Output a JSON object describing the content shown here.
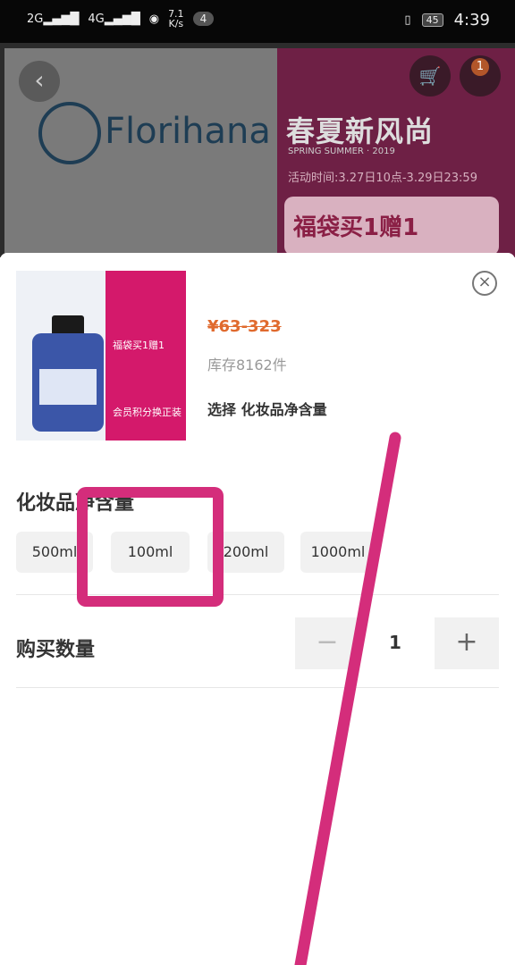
{
  "status_bar": {
    "net1": "2G",
    "net2": "4G",
    "speed_value": "7.1",
    "speed_unit": "K/s",
    "notif_count": "4",
    "battery": "45",
    "time": "4:39"
  },
  "background": {
    "brand": "Florihana",
    "promo_title": "春夏新风尚",
    "promo_subtitle": "SPRING SUMMER · 2019",
    "promo_time": "活动时间:3.27日10点-3.29日23:59",
    "promo_banner": "福袋买1赠1",
    "cart_badge": "1"
  },
  "sheet": {
    "thumb_text1": "福袋买1赠1",
    "thumb_text2": "会员积分换正装",
    "price": "¥63-323",
    "stock": "库存8162件",
    "choose": "选择 化妆品净含量",
    "section_title": "化妆品净含量",
    "options": [
      "500ml",
      "100ml",
      "200ml",
      "1000ml"
    ],
    "qty_label": "购买数量",
    "qty_minus": "−",
    "qty_value": "1",
    "qty_plus": "+"
  },
  "colors": {
    "accent": "#d42d7b",
    "price": "#e06a2e"
  }
}
